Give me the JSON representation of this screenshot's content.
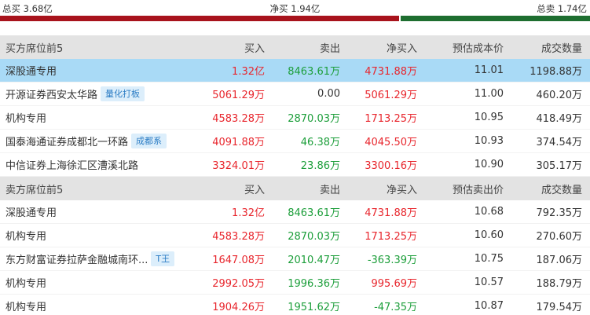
{
  "summary": {
    "total_buy": "总买 3.68亿",
    "net_buy": "净买 1.94亿",
    "total_sell": "总卖 1.74亿",
    "buy_ratio": 0.676
  },
  "colors": {
    "up": "#e8262d",
    "down": "#1c9e3a",
    "buy_bar": "#a8131c",
    "sell_bar": "#1e6e30",
    "highlight": "#a9daf6",
    "tag_bg": "#dceefb",
    "tag_text": "#2b7cc4"
  },
  "buy_section": {
    "headers": [
      "买方席位前5",
      "买入",
      "卖出",
      "净买入",
      "预估成本价",
      "成交数量"
    ],
    "rows": [
      {
        "name": "深股通专用",
        "tag": "",
        "buy": "1.32亿",
        "sell": "8463.61万",
        "net": "4731.88万",
        "price": "11.01",
        "volume": "1198.88万",
        "sell_color": "green",
        "net_color": "red",
        "highlighted": true
      },
      {
        "name": "开源证券西安太华路",
        "tag": "量化打板",
        "buy": "5061.29万",
        "sell": "0.00",
        "net": "5061.29万",
        "price": "11.00",
        "volume": "460.20万",
        "sell_color": "black",
        "net_color": "red",
        "highlighted": false
      },
      {
        "name": "机构专用",
        "tag": "",
        "buy": "4583.28万",
        "sell": "2870.03万",
        "net": "1713.25万",
        "price": "10.95",
        "volume": "418.49万",
        "sell_color": "green",
        "net_color": "red",
        "highlighted": false
      },
      {
        "name": "国泰海通证券成都北一环路",
        "tag": "成都系",
        "buy": "4091.88万",
        "sell": "46.38万",
        "net": "4045.50万",
        "price": "10.93",
        "volume": "374.54万",
        "sell_color": "green",
        "net_color": "red",
        "highlighted": false
      },
      {
        "name": "中信证券上海徐汇区漕溪北路",
        "tag": "",
        "buy": "3324.01万",
        "sell": "23.86万",
        "net": "3300.16万",
        "price": "10.90",
        "volume": "305.17万",
        "sell_color": "green",
        "net_color": "red",
        "highlighted": false
      }
    ]
  },
  "sell_section": {
    "headers": [
      "卖方席位前5",
      "买入",
      "卖出",
      "净买入",
      "预估卖出价",
      "成交数量"
    ],
    "rows": [
      {
        "name": "深股通专用",
        "tag": "",
        "buy": "1.32亿",
        "sell": "8463.61万",
        "net": "4731.88万",
        "price": "10.68",
        "volume": "792.35万",
        "sell_color": "green",
        "net_color": "red",
        "highlighted": false
      },
      {
        "name": "机构专用",
        "tag": "",
        "buy": "4583.28万",
        "sell": "2870.03万",
        "net": "1713.25万",
        "price": "10.60",
        "volume": "270.60万",
        "sell_color": "green",
        "net_color": "red",
        "highlighted": false
      },
      {
        "name": "东方财富证券拉萨金融城南环...",
        "tag": "T王",
        "buy": "1647.08万",
        "sell": "2010.47万",
        "net": "-363.39万",
        "price": "10.75",
        "volume": "187.06万",
        "sell_color": "green",
        "net_color": "green",
        "highlighted": false
      },
      {
        "name": "机构专用",
        "tag": "",
        "buy": "2992.05万",
        "sell": "1996.36万",
        "net": "995.69万",
        "price": "10.57",
        "volume": "188.79万",
        "sell_color": "green",
        "net_color": "red",
        "highlighted": false
      },
      {
        "name": "机构专用",
        "tag": "",
        "buy": "1904.26万",
        "sell": "1951.62万",
        "net": "-47.35万",
        "price": "10.87",
        "volume": "179.54万",
        "sell_color": "green",
        "net_color": "green",
        "highlighted": false
      }
    ]
  }
}
